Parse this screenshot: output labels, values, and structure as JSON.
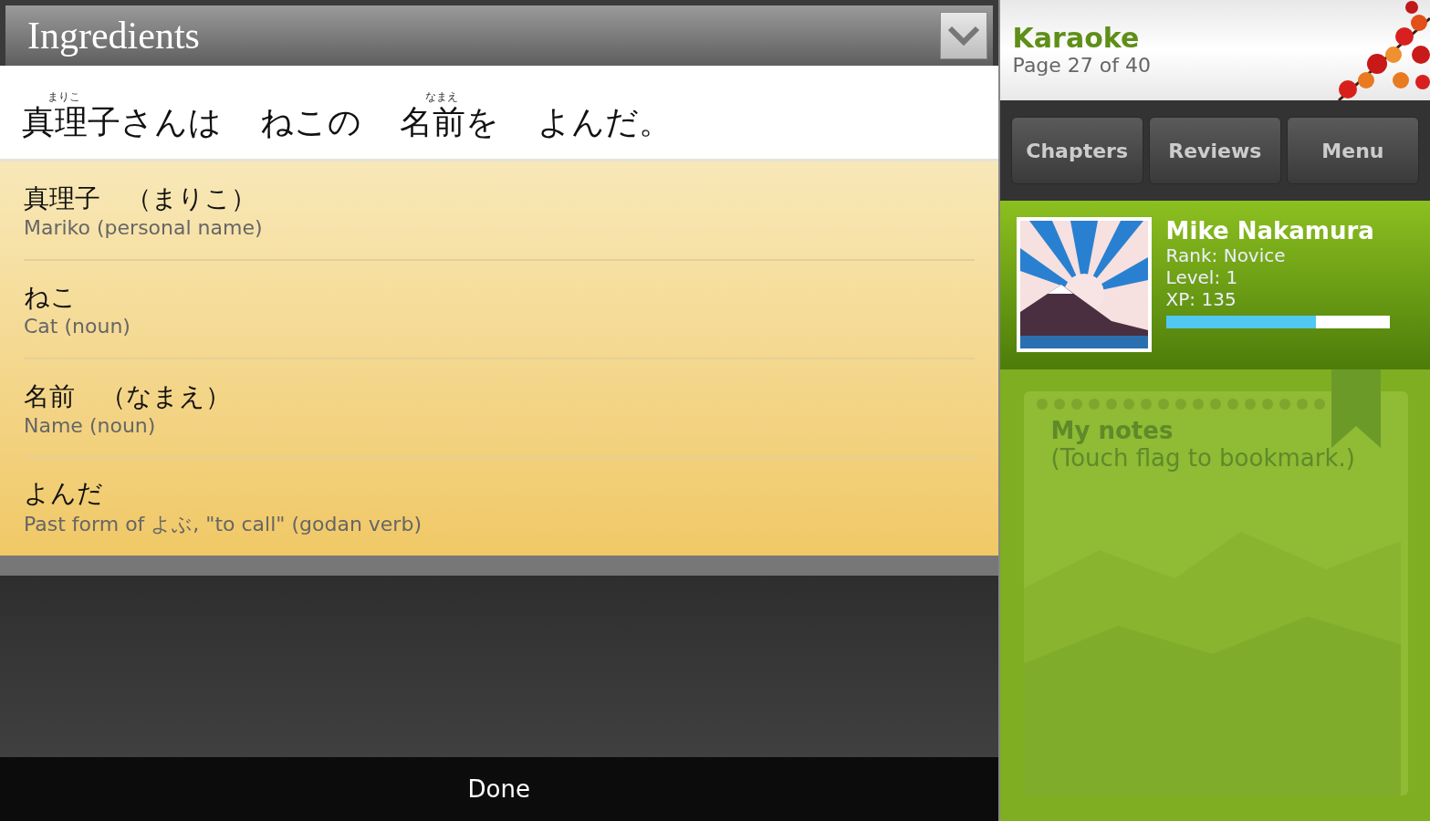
{
  "dialog": {
    "title": "Ingredients",
    "sentence": [
      {
        "text": "真理子さんは",
        "reading": "まりこ"
      },
      {
        "text": "ねこの"
      },
      {
        "text": "名前を",
        "reading": "なまえ"
      },
      {
        "text": "よんだ。"
      }
    ],
    "entries": [
      {
        "term": "真理子　（まりこ）",
        "meaning": "Mariko (personal name)"
      },
      {
        "term": "ねこ",
        "meaning": "Cat (noun)"
      },
      {
        "term": "名前　（なまえ）",
        "meaning": "Name (noun)"
      },
      {
        "term": "よんだ",
        "meaning": "Past form of よぶ, \"to call\" (godan verb)"
      }
    ],
    "done_button": "Done"
  },
  "sidebar": {
    "title": "Karaoke",
    "page": "Page 27 of 40",
    "buttons": [
      "Chapters",
      "Reviews",
      "Menu"
    ],
    "profile": {
      "name": "Mike Nakamura",
      "rank": "Rank: Novice",
      "level_text": "Level: 1",
      "xp": "XP: 135",
      "level": 0.67
    },
    "notes": {
      "title": "My notes",
      "hint": "(Touch flag to bookmark.)"
    }
  }
}
